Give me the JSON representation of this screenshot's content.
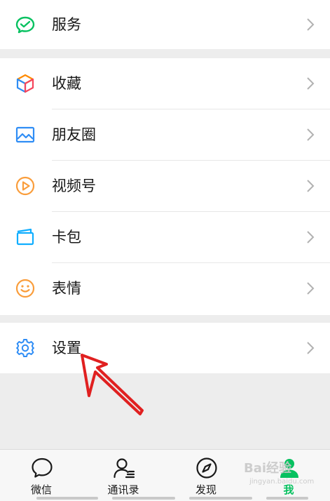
{
  "menu": {
    "service": "服务",
    "favorites": "收藏",
    "moments": "朋友圈",
    "channels": "视频号",
    "cards": "卡包",
    "stickers": "表情",
    "settings": "设置"
  },
  "tabs": [
    {
      "label": "微信",
      "icon": "chat-bubble-icon"
    },
    {
      "label": "通讯录",
      "icon": "contacts-icon"
    },
    {
      "label": "发现",
      "icon": "compass-icon"
    },
    {
      "label": "我",
      "icon": "profile-icon",
      "active": true
    }
  ],
  "watermark": {
    "brand": "Bai经验",
    "url": "jingyan.baidu.com"
  },
  "colors": {
    "accent": "#07c160",
    "arrow": "#e02020",
    "background": "#ededed"
  }
}
